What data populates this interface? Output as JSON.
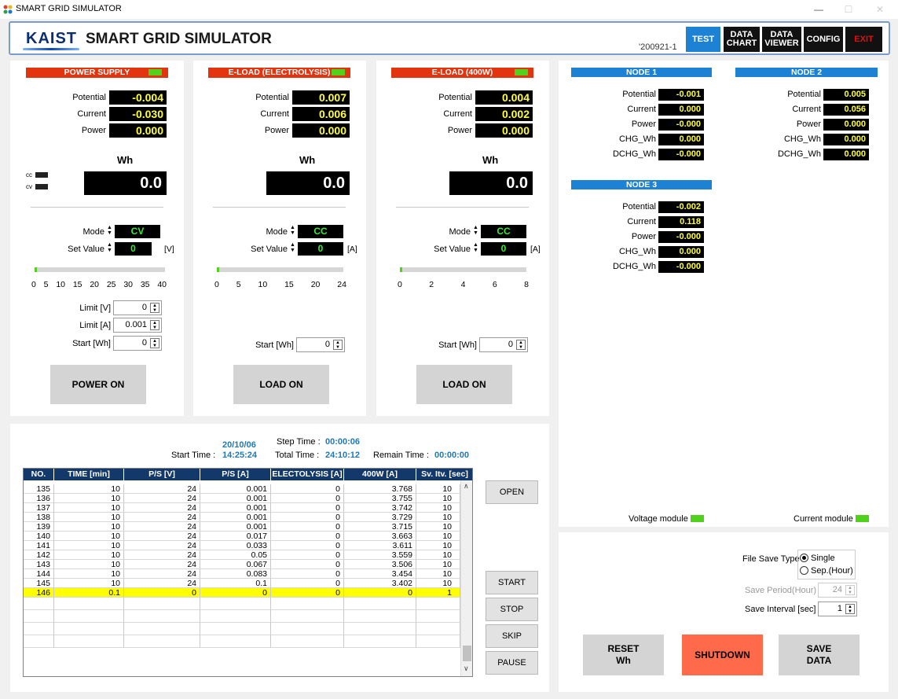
{
  "window": {
    "title": "SMART GRID SIMULATOR",
    "minimize": "—",
    "maximize": "☐",
    "close": "✕"
  },
  "header": {
    "brand": "KAIST",
    "title": "SMART GRID SIMULATOR",
    "version": "'200921-1",
    "buttons": {
      "test": "TEST",
      "data_chart_1": "DATA",
      "data_chart_2": "CHART",
      "data_viewer_1": "DATA",
      "data_viewer_2": "VIEWER",
      "config": "CONFIG",
      "exit": "EXIT"
    }
  },
  "labels": {
    "potential": "Potential",
    "current": "Current",
    "power": "Power",
    "wh": "Wh",
    "cc": "cc",
    "cv": "cv",
    "mode": "Mode",
    "set_value": "Set Value",
    "limit_v": "Limit [V]",
    "limit_a": "Limit [A]",
    "start_wh": "Start [Wh]",
    "chg_wh": "CHG_Wh",
    "dchg_wh": "DCHG_Wh"
  },
  "power_supply": {
    "title": "POWER SUPPLY",
    "potential": "-0.004",
    "current": "-0.030",
    "power": "0.000",
    "wh": "0.0",
    "mode": "CV",
    "set_value": "0",
    "unit": "[V]",
    "slider_fraction": 0.0,
    "scale": [
      "0",
      "5",
      "10",
      "15",
      "20",
      "25",
      "30",
      "35",
      "40"
    ],
    "limit_v": "0",
    "limit_a": "0.001",
    "start_wh": "0",
    "button": "POWER ON"
  },
  "eload_electrolysis": {
    "title": "E-LOAD (ELECTROLYSIS)",
    "potential": "0.007",
    "current": "0.006",
    "power": "0.000",
    "wh": "0.0",
    "mode": "CC",
    "set_value": "0",
    "unit": "[A]",
    "slider_fraction": 0.0,
    "scale": [
      "0",
      "5",
      "10",
      "15",
      "20",
      "24"
    ],
    "start_wh": "0",
    "button": "LOAD ON"
  },
  "eload_400w": {
    "title": "E-LOAD (400W)",
    "potential": "0.004",
    "current": "0.002",
    "power": "0.000",
    "wh": "0.0",
    "mode": "CC",
    "set_value": "0",
    "unit": "[A]",
    "slider_fraction": 0.0,
    "scale": [
      "0",
      "2",
      "4",
      "6",
      "8"
    ],
    "start_wh": "0",
    "button": "LOAD ON"
  },
  "nodes": {
    "node1": {
      "title": "NODE 1",
      "potential": "-0.001",
      "current": "0.000",
      "power": "-0.000",
      "chg_wh": "0.000",
      "dchg_wh": "-0.000"
    },
    "node2": {
      "title": "NODE 2",
      "potential": "0.005",
      "current": "0.056",
      "power": "0.000",
      "chg_wh": "0.000",
      "dchg_wh": "0.000"
    },
    "node3": {
      "title": "NODE 3",
      "potential": "-0.002",
      "current": "0.118",
      "power": "-0.000",
      "chg_wh": "0.000",
      "dchg_wh": "-0.000"
    },
    "voltage_module": "Voltage module",
    "current_module": "Current module"
  },
  "timing": {
    "date": "20/10/06",
    "start_time_label": "Start Time :",
    "start_time": "14:25:24",
    "step_time_label": "Step Time :",
    "step_time": "00:00:06",
    "total_time_label": "Total Time :",
    "total_time": "24:10:12",
    "remain_time_label": "Remain Time :",
    "remain_time": "00:00:00"
  },
  "table": {
    "headers": [
      "NO.",
      "TIME [min]",
      "P/S [V]",
      "P/S [A]",
      "ELECTOLYSIS [A]",
      "400W [A]",
      "Sv. Itv. [sec]"
    ],
    "rows": [
      [
        "135",
        "10",
        "24",
        "0.001",
        "0",
        "3.768",
        "10"
      ],
      [
        "136",
        "10",
        "24",
        "0.001",
        "0",
        "3.755",
        "10"
      ],
      [
        "137",
        "10",
        "24",
        "0.001",
        "0",
        "3.742",
        "10"
      ],
      [
        "138",
        "10",
        "24",
        "0.001",
        "0",
        "3.729",
        "10"
      ],
      [
        "139",
        "10",
        "24",
        "0.001",
        "0",
        "3.715",
        "10"
      ],
      [
        "140",
        "10",
        "24",
        "0.017",
        "0",
        "3.663",
        "10"
      ],
      [
        "141",
        "10",
        "24",
        "0.033",
        "0",
        "3.611",
        "10"
      ],
      [
        "142",
        "10",
        "24",
        "0.05",
        "0",
        "3.559",
        "10"
      ],
      [
        "143",
        "10",
        "24",
        "0.067",
        "0",
        "3.506",
        "10"
      ],
      [
        "144",
        "10",
        "24",
        "0.083",
        "0",
        "3.454",
        "10"
      ],
      [
        "145",
        "10",
        "24",
        "0.1",
        "0",
        "3.402",
        "10"
      ],
      [
        "146",
        "0.1",
        "0",
        "0",
        "0",
        "0",
        "1"
      ]
    ],
    "highlight_color": "#ffff00"
  },
  "controls": {
    "open": "OPEN",
    "start": "START",
    "stop": "STOP",
    "skip": "SKIP",
    "pause": "PAUSE"
  },
  "save": {
    "file_save_type_label": "File Save Type",
    "single": "Single",
    "sep_hour": "Sep.(Hour)",
    "save_period_label": "Save Period(Hour)",
    "save_period": "24",
    "save_interval_label": "Save Interval [sec]",
    "save_interval": "1",
    "reset_wh_1": "RESET",
    "reset_wh_2": "Wh",
    "shutdown": "SHUTDOWN",
    "save_data_1": "SAVE",
    "save_data_2": "DATA"
  },
  "colors": {
    "accent_red": "#e1340f",
    "accent_blue": "#1e82d4",
    "indicator_green": "#50d21c",
    "shutdown": "#ff6b4a",
    "exit": "#e01010",
    "test": "#1e82d4",
    "table_header": "#13386a"
  }
}
